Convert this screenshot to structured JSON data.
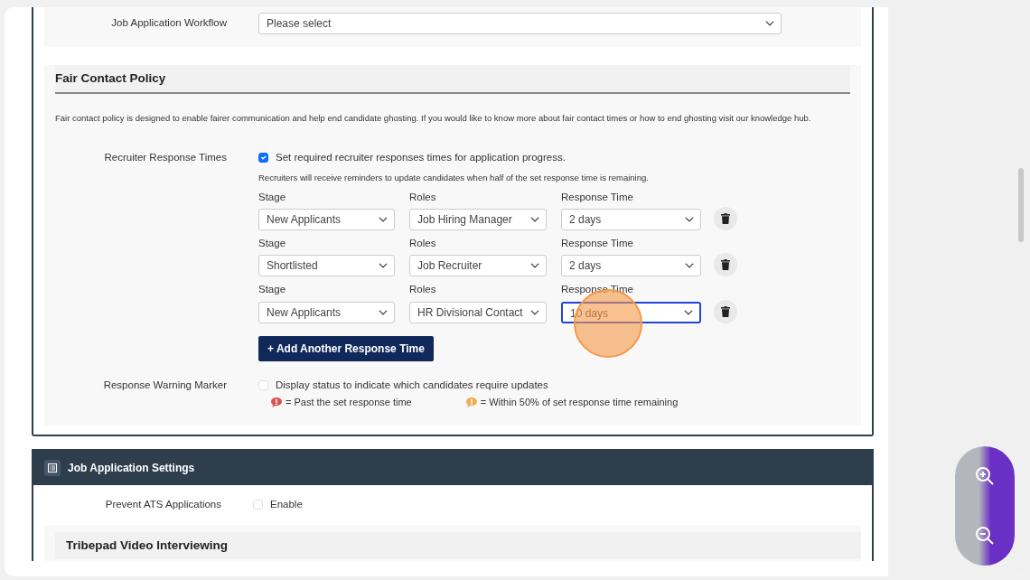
{
  "workflow_field": {
    "label": "Job Application Workflow",
    "value": "Please select"
  },
  "fair_contact": {
    "title": "Fair Contact Policy",
    "description": "Fair contact policy is designed to enable fairer communication and help end candidate ghosting. If you would like to know more about fair contact times or how to end ghosting visit our knowledge hub.",
    "recruiter_response": {
      "label": "Recruiter Response Times",
      "checkbox_text": "Set required recruiter responses times for application progress.",
      "checked": true,
      "hint": "Recruiters will receive reminders to update candidates when half of the set response time is remaining.",
      "rules": [
        {
          "stage_label": "Stage",
          "stage": "New Applicants",
          "roles_label": "Roles",
          "role": "Job Hiring Manager",
          "time_label": "Response Time",
          "time": "2 days",
          "focused": false
        },
        {
          "stage_label": "Stage",
          "stage": "Shortlisted",
          "roles_label": "Roles",
          "role": "Job Recruiter",
          "time_label": "Response Time",
          "time": "2 days",
          "focused": false
        },
        {
          "stage_label": "Stage",
          "stage": "New Applicants",
          "roles_label": "Roles",
          "role": "HR Divisional Contact",
          "time_label": "Response Time",
          "time": "10 days",
          "focused": true
        }
      ],
      "add_button": "+ Add Another Response Time"
    },
    "warning_marker": {
      "label": "Response Warning Marker",
      "checkbox_text": "Display status to indicate which candidates require updates",
      "checked": false,
      "legend": [
        {
          "text": "= Past the set response time",
          "color": "#d9534f"
        },
        {
          "text": "= Within 50% of set response time remaining",
          "color": "#f0ad4e"
        }
      ]
    }
  },
  "job_application_settings": {
    "title": "Job Application Settings",
    "prevent_ats": {
      "label": "Prevent ATS Applications",
      "checkbox_text": "Enable",
      "checked": false
    }
  },
  "video_section": {
    "title": "Tribepad Video Interviewing"
  }
}
